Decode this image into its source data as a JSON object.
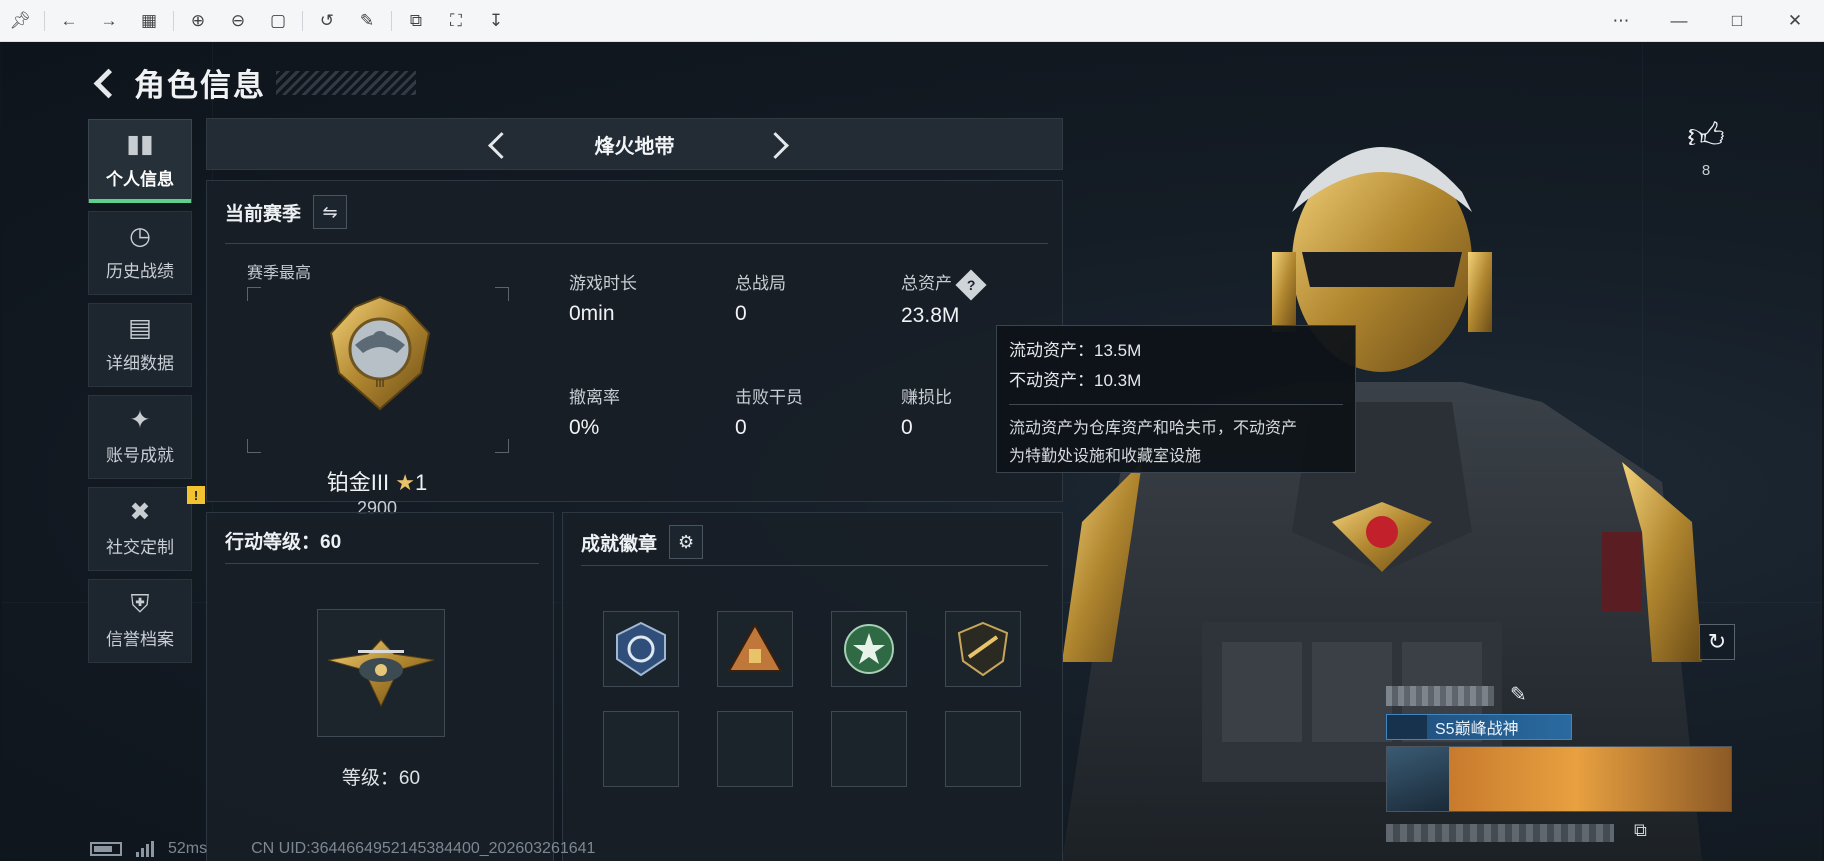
{
  "toolbar": {
    "left_icons": [
      "pin-icon",
      "back-icon",
      "forward-icon",
      "grid-icon",
      "zoom-in-icon",
      "zoom-out-icon",
      "fit-icon",
      "rotate-icon",
      "edit-icon",
      "copy-icon",
      "crop-icon",
      "save-icon"
    ],
    "right_icons": [
      "more-icon",
      "minimize-icon",
      "maximize-icon",
      "close-icon"
    ]
  },
  "header": {
    "title": "角色信息"
  },
  "sidebar": {
    "items": [
      {
        "label": "个人信息",
        "icon": "bar-chart-icon",
        "active": true
      },
      {
        "label": "历史战绩",
        "icon": "clock-icon"
      },
      {
        "label": "详细数据",
        "icon": "folder-icon"
      },
      {
        "label": "账号成就",
        "icon": "medal-icon"
      },
      {
        "label": "社交定制",
        "icon": "tools-icon",
        "badge": "!"
      },
      {
        "label": "信誉档案",
        "icon": "shield-icon"
      }
    ]
  },
  "mode": {
    "title": "烽火地带"
  },
  "season": {
    "title": "当前赛季",
    "best_label": "赛季最高",
    "rank_name": "铂金III",
    "rank_stars": "1",
    "rank_score": "2900",
    "stats": [
      {
        "label": "游戏时长",
        "value": "0min"
      },
      {
        "label": "总战局",
        "value": "0"
      },
      {
        "label": "总资产",
        "value": "23.8M"
      },
      {
        "label": "撤离率",
        "value": "0%"
      },
      {
        "label": "击败干员",
        "value": "0"
      },
      {
        "label": "赚损比",
        "value": "0"
      }
    ]
  },
  "tooltip": {
    "liquid": "流动资产：13.5M",
    "fixed": "不动资产：10.3M",
    "note_line1": "流动资产为仓库资产和哈夫币，不动资产",
    "note_line2": "为特勤处设施和收藏室设施"
  },
  "level": {
    "title": "行动等级：60",
    "caption": "等级：60"
  },
  "badges": {
    "title": "成就徽章"
  },
  "footer": {
    "ping": "52ms",
    "uid": "CN UID:3644664952145384400_202603261641"
  },
  "like": {
    "count": "8"
  },
  "player": {
    "title_tag": "S5巅峰战神"
  },
  "colors": {
    "accent_green": "#5fcf8e",
    "warning": "#f2c230",
    "gold": "#e8c36a"
  }
}
